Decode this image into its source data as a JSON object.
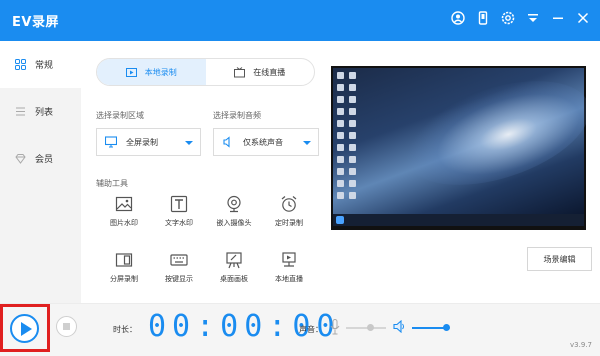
{
  "app": {
    "title": "EV录屏",
    "version": "v3.9.7"
  },
  "titlebar_icons": [
    "user-icon",
    "phone-icon",
    "settings-icon",
    "dropdown-menu-icon",
    "minimize-icon",
    "close-icon"
  ],
  "sidebar": {
    "items": [
      {
        "label": "常规",
        "icon": "grid-icon",
        "active": true
      },
      {
        "label": "列表",
        "icon": "list-icon",
        "active": false
      },
      {
        "label": "会员",
        "icon": "diamond-icon",
        "active": false
      }
    ]
  },
  "mode_tabs": [
    {
      "label": "本地录制",
      "icon": "record-icon",
      "active": true
    },
    {
      "label": "在线直播",
      "icon": "tv-icon",
      "active": false
    }
  ],
  "area": {
    "label": "选择录制区域",
    "value": "全屏录制",
    "icon": "monitor-icon"
  },
  "audio": {
    "label": "选择录制音频",
    "value": "仅系统声音",
    "icon": "speaker-icon"
  },
  "tools": {
    "label": "辅助工具",
    "items": [
      {
        "label": "图片水印",
        "icon": "image-icon"
      },
      {
        "label": "文字水印",
        "icon": "text-icon"
      },
      {
        "label": "嵌入摄像头",
        "icon": "camera-icon"
      },
      {
        "label": "定时录制",
        "icon": "alarm-icon"
      },
      {
        "label": "分屏录制",
        "icon": "split-screen-icon"
      },
      {
        "label": "按键显示",
        "icon": "keyboard-icon"
      },
      {
        "label": "桌面画板",
        "icon": "easel-icon"
      },
      {
        "label": "本地直播",
        "icon": "broadcast-icon"
      }
    ]
  },
  "scene_button": "场景编辑",
  "bottom": {
    "duration_label": "时长：",
    "timer": "00:00:00",
    "volume_label": "声音：",
    "mic_level": 0.6,
    "speaker_level": 0.9
  },
  "colors": {
    "accent": "#1a8cf0",
    "highlight": "#e02020"
  }
}
